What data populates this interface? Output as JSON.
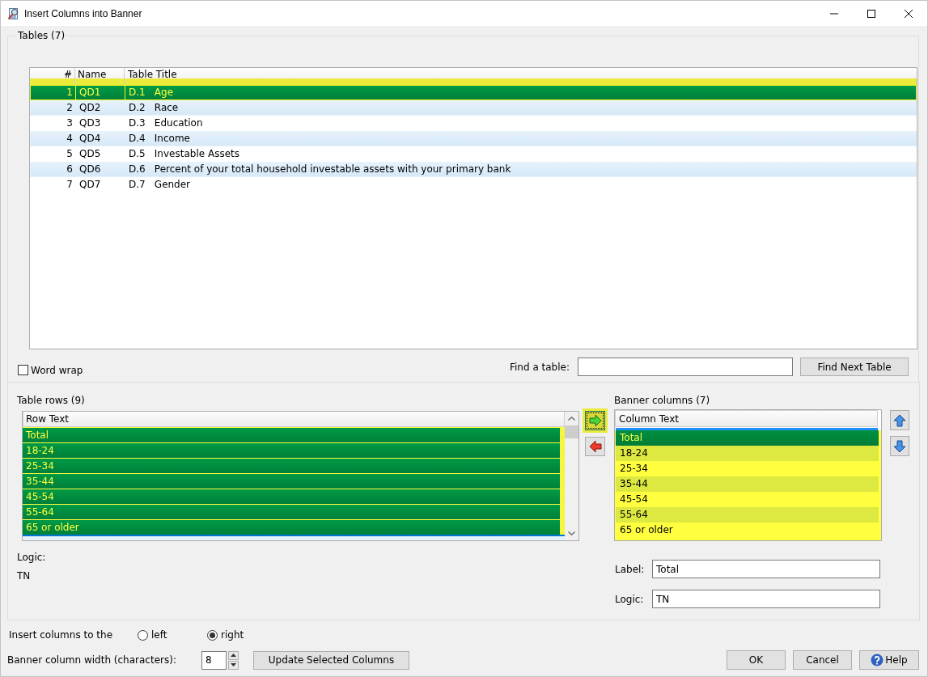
{
  "window": {
    "title": "Insert Columns into Banner"
  },
  "tables": {
    "title": "Tables (7)",
    "columns": [
      "#",
      "Name",
      "Table Title"
    ],
    "rows": [
      {
        "number": "1",
        "name": "QD1",
        "code": "D.1",
        "title": "Age",
        "selected": true
      },
      {
        "number": "2",
        "name": "QD2",
        "code": "D.2",
        "title": "Race",
        "selected": false
      },
      {
        "number": "3",
        "name": "QD3",
        "code": "D.3",
        "title": "Education",
        "selected": false
      },
      {
        "number": "4",
        "name": "QD4",
        "code": "D.4",
        "title": "Income",
        "selected": false
      },
      {
        "number": "5",
        "name": "QD5",
        "code": "D.5",
        "title": "Investable Assets",
        "selected": false
      },
      {
        "number": "6",
        "name": "QD6",
        "code": "D.6",
        "title": "Percent of your total household investable assets with your primary bank",
        "selected": false
      },
      {
        "number": "7",
        "name": "QD7",
        "code": "D.7",
        "title": "Gender",
        "selected": false
      }
    ]
  },
  "word_wrap": {
    "label": "Word wrap",
    "checked": false
  },
  "find_table": {
    "label": "Find a table:",
    "button": "Find Next Table"
  },
  "table_rows": {
    "title": "Table rows (9)",
    "column": "Row Text",
    "rows": [
      {
        "text": "Total",
        "selected": true
      },
      {
        "text": "18-24",
        "selected": true
      },
      {
        "text": "25-34",
        "selected": true
      },
      {
        "text": "35-44",
        "selected": true
      },
      {
        "text": "45-54",
        "selected": true
      },
      {
        "text": "55-64",
        "selected": true
      },
      {
        "text": "65 or older",
        "selected": true
      }
    ]
  },
  "move_buttons": [
    {
      "kind": "right",
      "focused": true
    },
    {
      "kind": "left",
      "focused": false
    }
  ],
  "row_logic": {
    "label": "Logic:",
    "value": "TN"
  },
  "banner_columns": {
    "title": "Banner columns (7)",
    "column": "Column Text",
    "rows": [
      {
        "text": "Total",
        "selected": true
      },
      {
        "text": "18-24",
        "selected": false
      },
      {
        "text": "25-34",
        "selected": false
      },
      {
        "text": "35-44",
        "selected": false
      },
      {
        "text": "45-54",
        "selected": false
      },
      {
        "text": "55-64",
        "selected": false
      },
      {
        "text": "65 or older",
        "selected": false
      }
    ]
  },
  "order_buttons": [
    {
      "kind": "up"
    },
    {
      "kind": "down"
    }
  ],
  "label_field": {
    "label": "Label:",
    "value": "Total"
  },
  "logic_field": {
    "label": "Logic:",
    "value": "TN"
  },
  "insert_side": {
    "label": "Insert columns to the",
    "options": [
      {
        "label": "left",
        "selected": false
      },
      {
        "label": "right",
        "selected": true
      }
    ]
  },
  "column_width": {
    "label": "Banner column width (characters):",
    "value": "8"
  },
  "update_button": {
    "label": "Update Selected Columns"
  },
  "dialog_buttons": [
    {
      "label": "OK",
      "kind": "plain"
    },
    {
      "label": "Cancel",
      "kind": "plain"
    },
    {
      "label": "Help",
      "kind": "help"
    }
  ]
}
